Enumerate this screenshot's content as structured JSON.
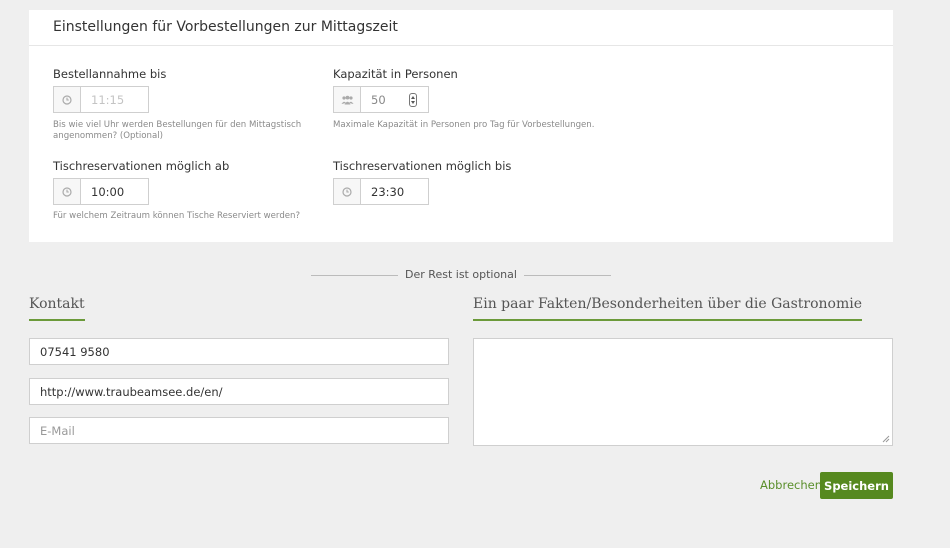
{
  "settings_card": {
    "title": "Einstellungen für Vorbestellungen zur Mittagszeit",
    "order_until": {
      "label": "Bestellannahme bis",
      "placeholder": "11:15",
      "icon": "clock-icon",
      "help": "Bis wie viel Uhr werden Bestellungen für den Mittagstisch angenommen? (Optional)"
    },
    "capacity": {
      "label": "Kapazität in Personen",
      "value": "50",
      "icon": "people-icon",
      "help": "Maximale Kapazität in Personen pro Tag für Vorbestellungen."
    },
    "reservations_from": {
      "label": "Tischreservationen möglich ab",
      "value": "10:00",
      "icon": "clock-icon",
      "help": "Für welchem Zeitraum können Tische Reserviert werden?"
    },
    "reservations_until": {
      "label": "Tischreservationen möglich bis",
      "value": "23:30",
      "icon": "clock-icon"
    }
  },
  "divider": {
    "text": "Der Rest ist optional"
  },
  "contact": {
    "title": "Kontakt",
    "phone": "07541 9580",
    "website": "http://www.traubeamsee.de/en/",
    "email_placeholder": "E-Mail"
  },
  "facts": {
    "title": "Ein paar Fakten/Besonderheiten über die Gastronomie",
    "value": ""
  },
  "actions": {
    "cancel_label": "Abbrechen",
    "save_label": "Speichern"
  },
  "colors": {
    "accent": "#56891f",
    "link": "#5a8f2b",
    "background": "#efefef"
  }
}
